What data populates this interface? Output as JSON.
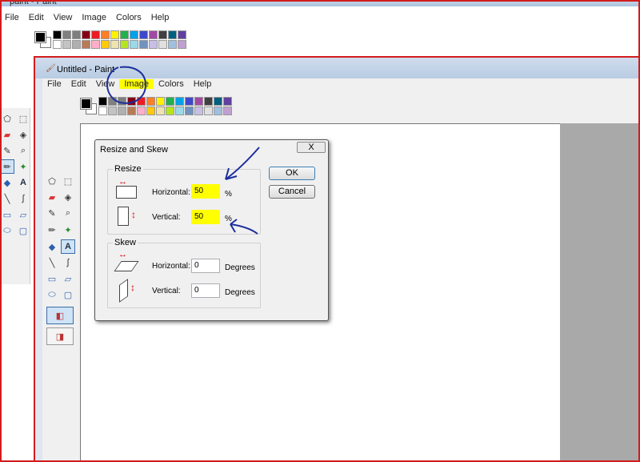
{
  "outer_window": {
    "title": "paint - Paint",
    "menu": [
      "File",
      "Edit",
      "View",
      "Image",
      "Colors",
      "Help"
    ]
  },
  "inner_window": {
    "title": "Untitled - Paint",
    "menu": [
      "File",
      "Edit",
      "View",
      "Image",
      "Colors",
      "Help"
    ]
  },
  "palette_colors": [
    "#000000",
    "#808080",
    "#7f7f7f",
    "#880015",
    "#ed1c24",
    "#ff7f27",
    "#fff200",
    "#22b14c",
    "#00a2e8",
    "#3f48cc",
    "#a349a4",
    "#404040",
    "#006080",
    "#6040a0",
    "#ffffff",
    "#c3c3c3",
    "#b0b0b0",
    "#b97a57",
    "#ffaec9",
    "#ffc90e",
    "#efe4b0",
    "#b5e61d",
    "#99d9ea",
    "#7092be",
    "#c8bfe7",
    "#e0e0e0",
    "#a0c0e0",
    "#c0a0d0"
  ],
  "dialog": {
    "title": "Resize and Skew",
    "close": "X",
    "resize": {
      "label": "Resize",
      "horizontal_label": "Horizontal:",
      "horizontal_value": "50",
      "horizontal_unit": "%",
      "vertical_label": "Vertical:",
      "vertical_value": "50",
      "vertical_unit": "%"
    },
    "skew": {
      "label": "Skew",
      "horizontal_label": "Horizontal:",
      "horizontal_value": "0",
      "horizontal_unit": "Degrees",
      "vertical_label": "Vertical:",
      "vertical_value": "0",
      "vertical_unit": "Degrees"
    },
    "ok": "OK",
    "cancel": "Cancel"
  },
  "colors": {
    "highlight": "#ffff00",
    "annotation_ink": "#1b2f9e",
    "red_border": "#d21c1c"
  }
}
